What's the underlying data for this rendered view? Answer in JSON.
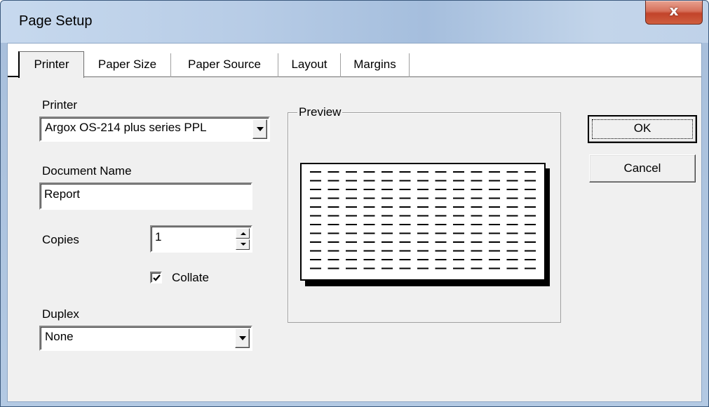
{
  "window": {
    "title": "Page Setup",
    "close_label": "x"
  },
  "tabs": [
    {
      "label": "Printer",
      "active": true
    },
    {
      "label": "Paper Size",
      "active": false
    },
    {
      "label": "Paper Source",
      "active": false
    },
    {
      "label": "Layout",
      "active": false
    },
    {
      "label": "Margins",
      "active": false
    }
  ],
  "printer": {
    "label": "Printer",
    "selected": "Argox OS-214 plus series PPL"
  },
  "document_name": {
    "label": "Document Name",
    "value": "Report"
  },
  "copies": {
    "label": "Copies",
    "value": "1"
  },
  "collate": {
    "label": "Collate",
    "checked": true
  },
  "duplex": {
    "label": "Duplex",
    "selected": "None"
  },
  "preview": {
    "label": "Preview",
    "line_rows": 12,
    "line_cols": 13
  },
  "buttons": {
    "ok": "OK",
    "cancel": "Cancel"
  }
}
